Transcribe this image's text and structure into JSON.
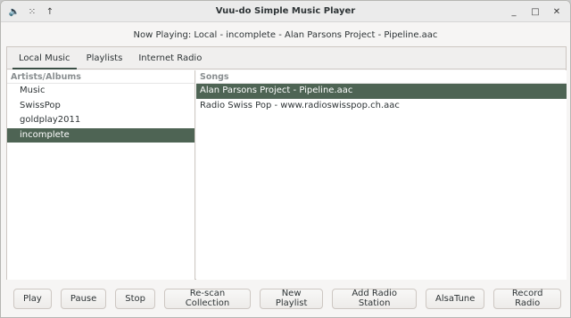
{
  "window": {
    "title": "Vuu-do Simple Music Player"
  },
  "titlebar": {
    "left_icons": [
      "speaker-icon",
      "grip-icon",
      "arrow-up-icon"
    ],
    "minimize_glyph": "_",
    "maximize_glyph": "□",
    "close_glyph": "✕",
    "speaker_glyph": "🔈",
    "grip_glyph": "⁙",
    "arrow_glyph": "↑"
  },
  "now_playing": "Now Playing: Local - incomplete - Alan Parsons Project - Pipeline.aac",
  "tabs": [
    {
      "label": "Local Music",
      "active": true
    },
    {
      "label": "Playlists",
      "active": false
    },
    {
      "label": "Internet Radio",
      "active": false
    }
  ],
  "artists": {
    "header": "Artists/Albums",
    "items": [
      {
        "label": "Music",
        "selected": false
      },
      {
        "label": "SwissPop",
        "selected": false
      },
      {
        "label": "goldplay2011",
        "selected": false
      },
      {
        "label": "incomplete",
        "selected": true
      }
    ]
  },
  "songs": {
    "header": "Songs",
    "items": [
      {
        "label": "Alan Parsons Project - Pipeline.aac",
        "selected": true
      },
      {
        "label": "Radio Swiss Pop - www.radioswisspop.ch.aac",
        "selected": false
      }
    ]
  },
  "buttons": {
    "play": "Play",
    "pause": "Pause",
    "stop": "Stop",
    "rescan": "Re-scan Collection",
    "new_playlist": "New Playlist",
    "add_radio": "Add Radio Station",
    "alsatune": "AlsaTune",
    "record_radio": "Record Radio"
  },
  "colors": {
    "selection": "#4e6454",
    "tab_indicator": "#3b4f45"
  }
}
